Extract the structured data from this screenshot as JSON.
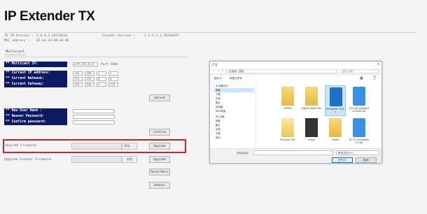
{
  "header": {
    "title": "IP Extender TX",
    "tx_fw_label": "TX FW Version :",
    "tx_fw_value": "4.6.0.2.20170426",
    "mac_label": "MAC address :",
    "mac_value": "02-0e-34-00-02-0E",
    "encoder_label": "Encoder Version :",
    "encoder_value": "1.1.2.1.1.20160425"
  },
  "tabs": {
    "current": "Multicast"
  },
  "multicast": {
    "label": "** Multicast IP:",
    "value": "239.255.0.0",
    "port": "Port 5004"
  },
  "network": {
    "labels": [
      "** Current IP address:",
      "** Current Netmask:",
      "** Current Gateway:"
    ],
    "ip": [
      "192",
      "168",
      "1",
      "2"
    ],
    "netmask": [
      "255",
      "255",
      "0",
      "0"
    ],
    "gateway": [
      "192",
      "168",
      "1",
      "254"
    ],
    "upload_button": "Upload"
  },
  "account": {
    "labels": [
      "** New User Name :",
      "** Neuser Password:",
      "** Confirm password:"
    ],
    "confirm_button": "Confirm"
  },
  "firmware": {
    "label": "Upgrade Firmware:",
    "browse": "浏览...",
    "upgrade_button": "Upgrade"
  },
  "encoder_fw": {
    "label": "Upgrade Encoder Firmware:",
    "browse": "浏览",
    "upgrade_button": "Upgrade"
  },
  "extra_buttons": {
    "reset": "Reset(Res)",
    "reboot": "Reboot"
  },
  "dialog": {
    "title": "打开",
    "close": "✕",
    "address": "› 此电脑 › 桌面",
    "search": "搜索\"桌面\"",
    "toolbar_organize": "组织 ▾",
    "toolbar_new_folder": "新建文件夹",
    "tree": [
      "★ 快速访问",
      "桌面",
      "下载",
      "文档",
      "图片",
      "此电脑",
      "WPS网盘",
      "3D 对象",
      "视频",
      "图片",
      "文档",
      "下载",
      "音乐"
    ],
    "files": [
      {
        "name": "180612",
        "icon": "folder"
      },
      {
        "name": "Always Switch Bin",
        "icon": "folder"
      },
      {
        "name": "IPExtender TX.bin",
        "icon": "ie"
      },
      {
        "name": "C21-18-Lastestk-TX-n0402-06",
        "icon": "ie-l"
      },
      {
        "name": "RFmodel Test",
        "icon": "folder-open"
      },
      {
        "name": "Image",
        "icon": "dark"
      },
      {
        "name": "Model",
        "icon": "folder"
      },
      {
        "name": "RC TC Compatible 1.0.bin",
        "icon": "ie-l"
      }
    ],
    "filename_label": "文件名(N):",
    "filetype": "所有文件(*.*)",
    "open_button": "打开(O)",
    "cancel_button": "取消"
  }
}
